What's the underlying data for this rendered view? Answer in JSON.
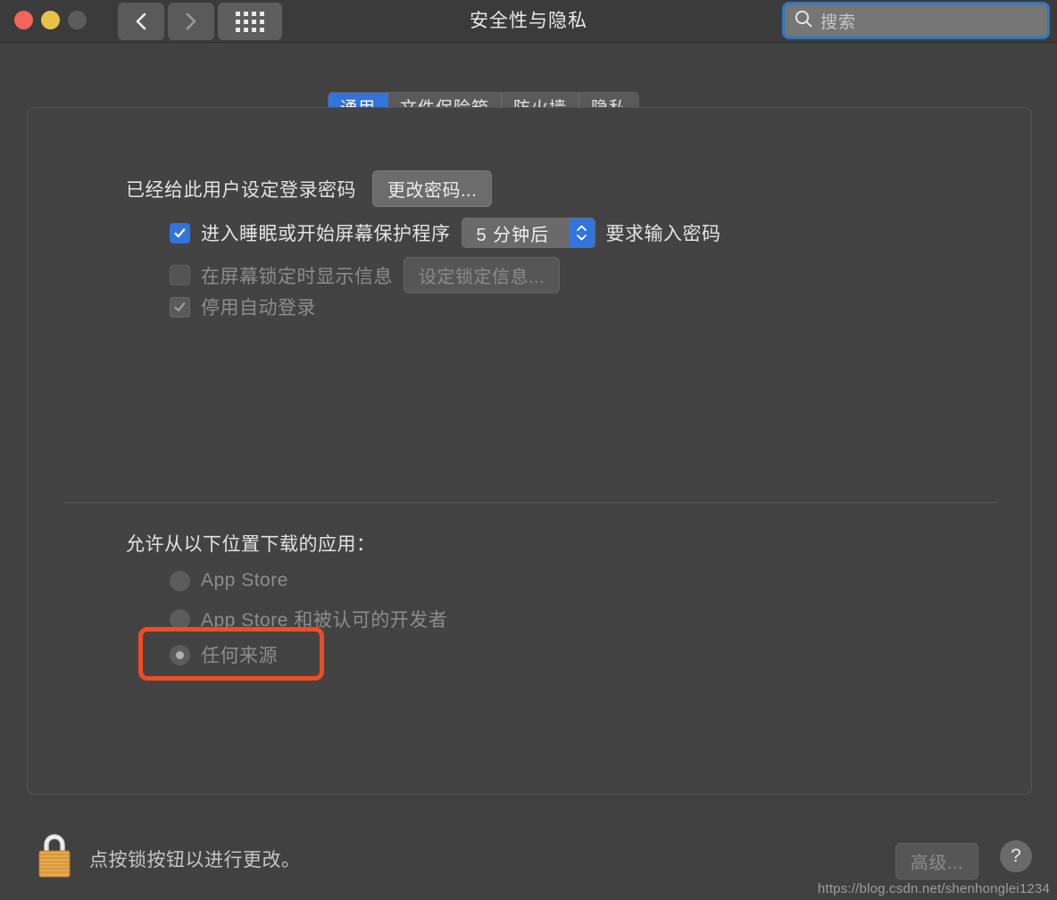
{
  "window": {
    "title": "安全性与隐私",
    "traffic_lights": [
      "close",
      "minimize",
      "zoom"
    ],
    "nav": {
      "back_icon": "chevron-left-icon",
      "forward_icon": "chevron-right-icon"
    },
    "grid_button_icon": "grid-apps-icon"
  },
  "search": {
    "placeholder": "搜索",
    "icon": "search-icon",
    "focus_color": "#2f78c4"
  },
  "tabs": [
    {
      "label": "通用",
      "active": true
    },
    {
      "label": "文件保险箱",
      "active": false
    },
    {
      "label": "防火墙",
      "active": false
    },
    {
      "label": "隐私",
      "active": false
    }
  ],
  "general": {
    "password_set_label": "已经给此用户设定登录密码",
    "change_password_button": "更改密码...",
    "require_password": {
      "checkbox_checked": true,
      "label_before": "进入睡眠或开始屏幕保护程序",
      "stepper_value": "5 分钟后",
      "label_after": "要求输入密码"
    },
    "lock_message": {
      "checkbox_checked": false,
      "enabled": false,
      "label": "在屏幕锁定时显示信息",
      "button": "设定锁定信息..."
    },
    "disable_auto_login": {
      "checkbox_checked": true,
      "enabled": false,
      "label": "停用自动登录"
    }
  },
  "download_sources": {
    "heading": "允许从以下位置下载的应用：",
    "options": [
      {
        "label": "App Store",
        "selected": false
      },
      {
        "label": "App Store 和被认可的开发者",
        "selected": false
      },
      {
        "label": "任何来源",
        "selected": true,
        "highlighted": true
      }
    ],
    "highlight_color": "#f04c22"
  },
  "footer": {
    "lock_icon": "padlock-closed-icon",
    "note": "点按锁按钮以进行更改。",
    "advanced_button": "高级...",
    "help_button": "?"
  },
  "watermark": "https://blog.csdn.net/shenhonglei1234"
}
